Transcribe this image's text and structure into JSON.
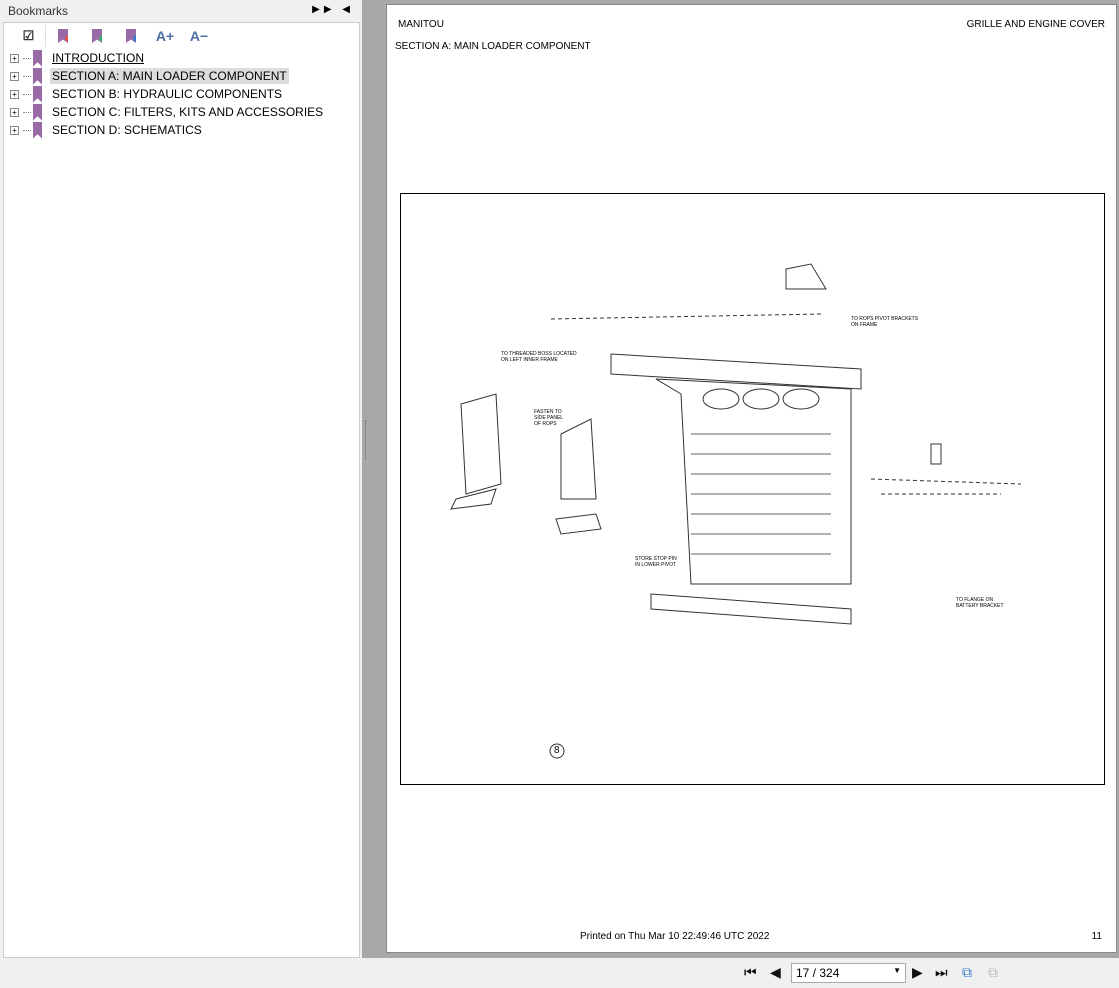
{
  "sidebar": {
    "title": "Bookmarks",
    "items": [
      {
        "label": "INTRODUCTION"
      },
      {
        "label": "SECTION A: MAIN LOADER COMPONENT"
      },
      {
        "label": "SECTION B: HYDRAULIC COMPONENTS"
      },
      {
        "label": "SECTION C: FILTERS, KITS AND ACCESSORIES"
      },
      {
        "label": "SECTION D: SCHEMATICS"
      }
    ],
    "toolbar": {
      "font_up": "A+",
      "font_down": "A−"
    }
  },
  "page": {
    "header_left": "MANITOU",
    "header_right": "GRILLE AND ENGINE COVER",
    "section": "SECTION A: MAIN LOADER COMPONENT",
    "callout": "8",
    "notes": [
      "TO ROPS PIVOT BRACKETS ON FRAME",
      "TO THREADED BOSS LOCATED ON LEFT INNER FRAME",
      "FASTEN TO SIDE PANEL OF ROPS",
      "STORE STOP PIN IN LOWER PIVOT",
      "TO FLANGE ON BATTERY BRACKET"
    ],
    "footer_printed": "Printed on  Thu Mar 10 22:49:46 UTC 2022",
    "page_number": "11"
  },
  "nav": {
    "page_value": "17 / 324"
  }
}
